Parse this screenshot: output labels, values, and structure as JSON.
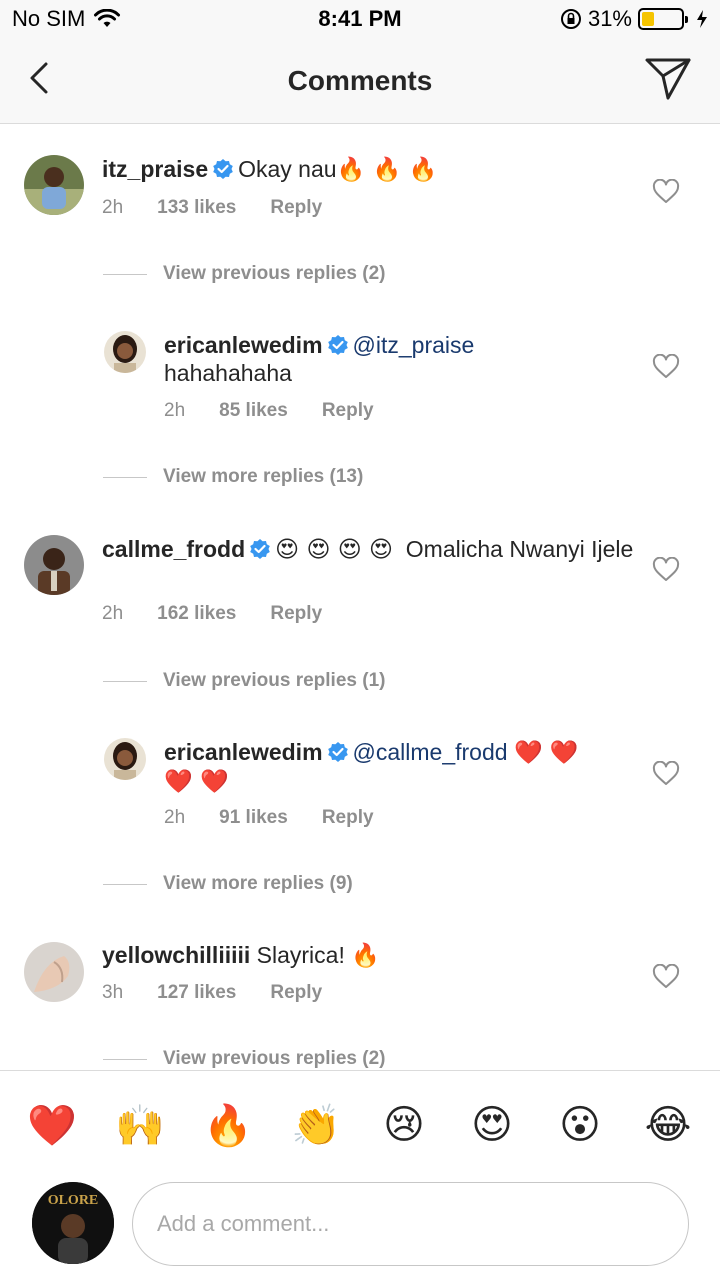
{
  "status_bar": {
    "carrier": "No SIM",
    "time": "8:41 PM",
    "battery": "31%",
    "battery_level": 0.31,
    "battery_color": "#f5c400"
  },
  "nav": {
    "title": "Comments",
    "back_icon": "chevron-left-icon",
    "send_icon": "paper-plane-icon"
  },
  "comments": [
    {
      "username": "itz_praise",
      "verified": true,
      "text": "Okay nau",
      "emoji": "🔥 🔥 🔥",
      "time": "2h",
      "likes": "133 likes",
      "reply": "Reply"
    },
    {
      "view_label": "View previous replies (2)"
    },
    {
      "username": "ericanlewedim",
      "verified": true,
      "mention": "@itz_praise",
      "text": "hahahahaha",
      "time": "2h",
      "likes": "85 likes",
      "reply": "Reply"
    },
    {
      "view_label": "View more replies (13)"
    },
    {
      "username": "callme_frodd",
      "verified": true,
      "emoji": "😍 😍 😍 😍",
      "text": "Omalicha Nwanyi Ijele",
      "time": "2h",
      "likes": "162 likes",
      "reply": "Reply"
    },
    {
      "view_label": "View previous replies (1)"
    },
    {
      "username": "ericanlewedim",
      "verified": true,
      "mention": "@callme_frodd",
      "emoji": "❤️ ❤️",
      "emoji2": "❤️ ❤️",
      "time": "2h",
      "likes": "91 likes",
      "reply": "Reply"
    },
    {
      "view_label": "View more replies (9)"
    },
    {
      "username": "yellowchilliiiii",
      "verified": false,
      "text": "Slayrica!",
      "emoji": "🔥",
      "time": "3h",
      "likes": "127 likes",
      "reply": "Reply"
    },
    {
      "view_label": "View previous replies (2)"
    }
  ],
  "emoji_bar": [
    "❤️",
    "🙌",
    "🔥",
    "👏",
    "😢",
    "😍",
    "😮",
    "😂"
  ],
  "composer": {
    "placeholder": "Add a comment...",
    "avatar_text": "OLORE"
  },
  "colors": {
    "verified_blue": "#3897f0",
    "mention_navy": "#1a3a6e",
    "meta_gray": "#8e8e8e"
  }
}
